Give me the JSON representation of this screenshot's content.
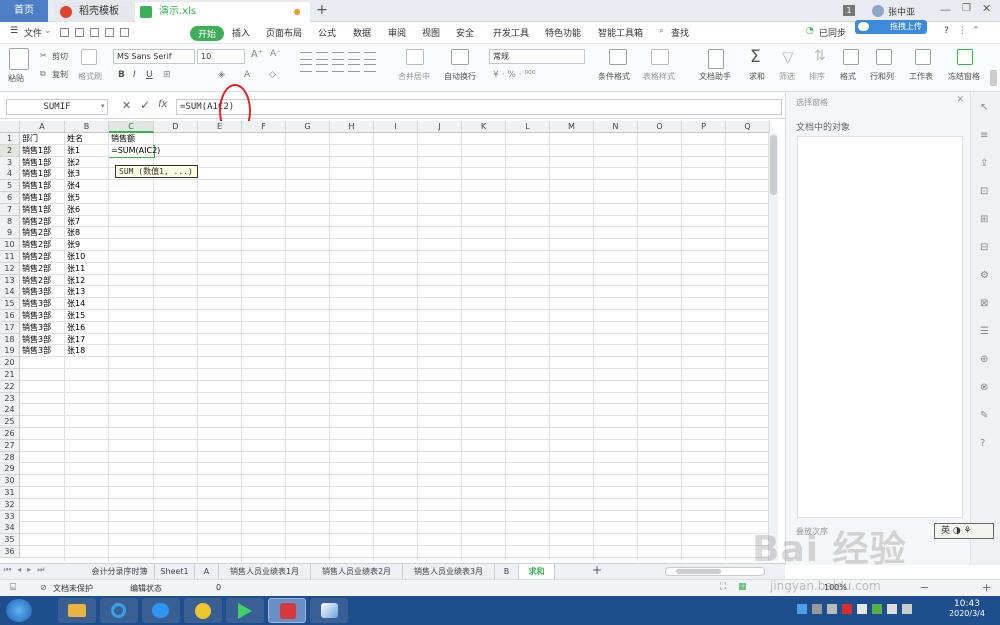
{
  "tabs": {
    "home": "首页",
    "docer": "稻壳模板",
    "file": "演示.xls",
    "page_num": "1",
    "user": "张中亚",
    "upload": "拖拽上传"
  },
  "menu": [
    "文件",
    "开始",
    "插入",
    "页面布局",
    "公式",
    "数据",
    "审阅",
    "视图",
    "安全",
    "开发工具",
    "特色功能",
    "智能工具箱",
    "查找"
  ],
  "menu_right": {
    "sync": "已同步",
    "help": "?"
  },
  "toolbar": {
    "paste": "粘贴",
    "cut": "剪切",
    "copy": "复制",
    "format_painter": "格式刷",
    "font": "MS Sans Serif",
    "size": "10",
    "merge": "合并居中",
    "wrap": "自动换行",
    "numfmt": "常规",
    "cond_fmt": "条件格式",
    "table_style": "表格样式",
    "doc_helper": "文档助手",
    "sum": "求和",
    "filter": "筛选",
    "sort": "排序",
    "format": "格式",
    "rowcol": "行和列",
    "sheet": "工作表",
    "freeze": "冻结窗格"
  },
  "formula_bar": {
    "name_box": "SUMIF",
    "formula": "=SUM(A1C2)",
    "fx": "fx"
  },
  "tooltip": "SUM (数值1, ...)",
  "columns": [
    "A",
    "B",
    "C",
    "D",
    "E",
    "F",
    "G",
    "H",
    "I",
    "J",
    "K",
    "L",
    "M",
    "N",
    "O",
    "P",
    "Q"
  ],
  "rows": [
    [
      "部门",
      "姓名",
      "销售额"
    ],
    [
      "销售1部",
      "张1",
      "=SUM(AIC2)"
    ],
    [
      "销售1部",
      "张2",
      ""
    ],
    [
      "销售1部",
      "张3",
      ""
    ],
    [
      "销售1部",
      "张4",
      ""
    ],
    [
      "销售1部",
      "张5",
      ""
    ],
    [
      "销售1部",
      "张6",
      ""
    ],
    [
      "销售2部",
      "张7",
      ""
    ],
    [
      "销售2部",
      "张8",
      ""
    ],
    [
      "销售2部",
      "张9",
      ""
    ],
    [
      "销售2部",
      "张10",
      ""
    ],
    [
      "销售2部",
      "张11",
      ""
    ],
    [
      "销售2部",
      "张12",
      ""
    ],
    [
      "销售3部",
      "张13",
      ""
    ],
    [
      "销售3部",
      "张14",
      ""
    ],
    [
      "销售3部",
      "张15",
      ""
    ],
    [
      "销售3部",
      "张16",
      ""
    ],
    [
      "销售3部",
      "张17",
      ""
    ],
    [
      "销售3部",
      "张18",
      ""
    ]
  ],
  "row_count": 36,
  "right_panel": {
    "title": "选择窗格",
    "subtitle": "文档中的对象",
    "order": "叠放次序"
  },
  "sheets": [
    "会计分录序时簿",
    "Sheet1",
    "A",
    "销售人员业绩表1月",
    "销售人员业绩表2月",
    "销售人员业绩表3月",
    "B",
    "求和"
  ],
  "active_sheet": "求和",
  "status": {
    "protect": "文档未保护",
    "edit": "编辑状态",
    "count": "0",
    "zoom": "100%"
  },
  "ime": "英",
  "watermark": "Bai 经验",
  "watermark_url": "jingyan.baidu.com",
  "clock": {
    "time": "10:43",
    "date": "2020/3/4"
  },
  "colors": {
    "accent_green": "#3fae58",
    "tab_blue": "#4d7fc6",
    "taskbar": "#1f4e8c",
    "annotation_red": "#e0242b"
  }
}
